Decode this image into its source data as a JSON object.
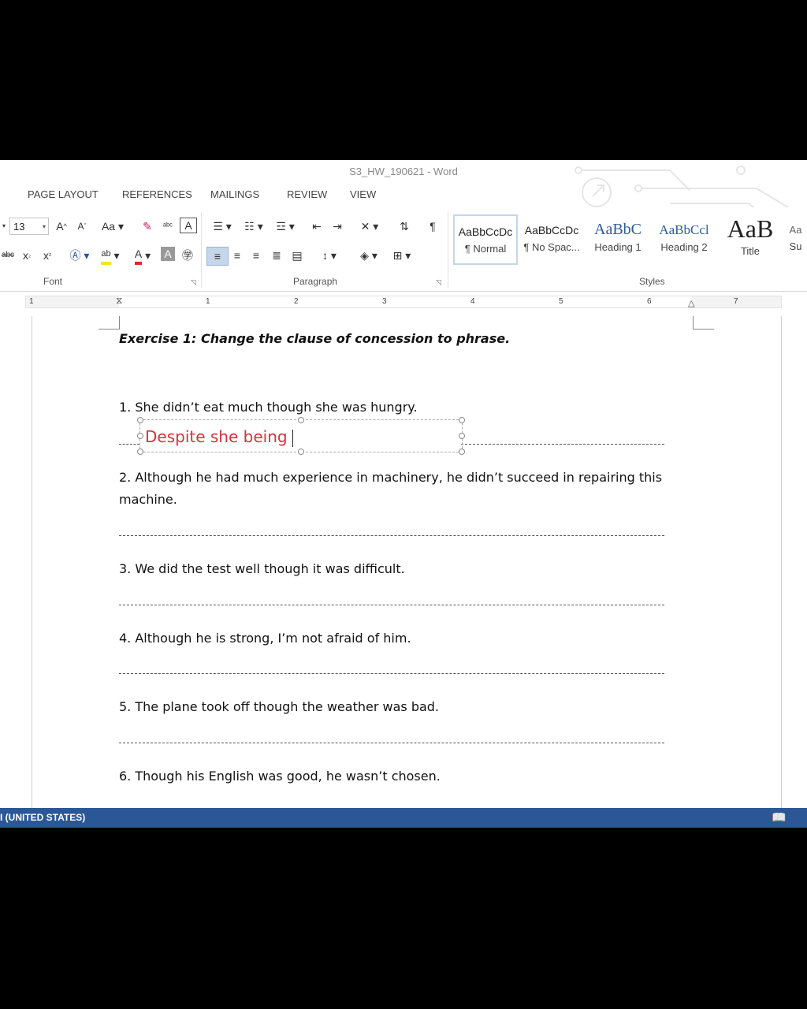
{
  "window": {
    "title": "S3_HW_190621 - Word"
  },
  "tabs": [
    "PAGE LAYOUT",
    "REFERENCES",
    "MAILINGS",
    "REVIEW",
    "VIEW"
  ],
  "ribbon": {
    "font_size": "13",
    "groups": {
      "font": "Font",
      "paragraph": "Paragraph",
      "styles": "Styles"
    },
    "styles": [
      {
        "preview": "AaBbCcDc",
        "name": "¶ Normal"
      },
      {
        "preview": "AaBbCcDc",
        "name": "¶ No Spac..."
      },
      {
        "preview": "AaBbC",
        "name": "Heading 1"
      },
      {
        "preview": "AaBbCcl",
        "name": "Heading 2"
      },
      {
        "preview": "AaB",
        "name": "Title"
      },
      {
        "preview": "Aa",
        "name": "Su"
      }
    ]
  },
  "ruler": {
    "numbers": [
      "1",
      "1",
      "2",
      "3",
      "4",
      "5",
      "6",
      "7"
    ]
  },
  "document": {
    "heading": "Exercise 1: Change the clause of concession to phrase.",
    "questions": [
      "1. She didn’t eat much though she was hungry.",
      "2. Although he had much experience in machinery, he didn’t succeed in repairing this machine.",
      "3. We did the test well though it was difficult.",
      "4. Although he is strong, I’m not afraid of him.",
      "5. The plane took off though the weather was bad.",
      "6. Though his English was good, he wasn’t chosen."
    ],
    "answer_typed": "Despite she being"
  },
  "statusbar": {
    "language": "I (UNITED STATES)"
  },
  "colors": {
    "statusbar": "#2b5797",
    "answer": "#d6333b"
  }
}
